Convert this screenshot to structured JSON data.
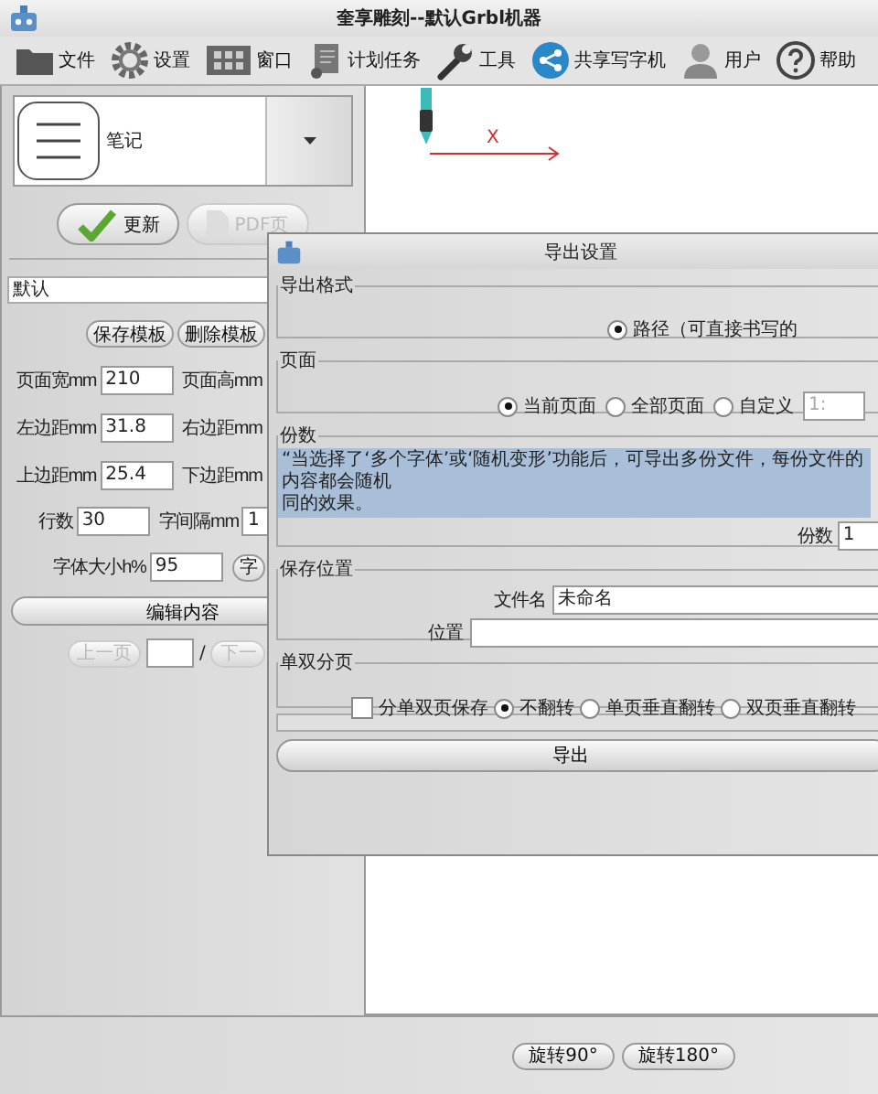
{
  "window": {
    "title": "奎享雕刻--默认Grbl机器"
  },
  "toolbar": [
    {
      "label": "文件",
      "kind": "folder"
    },
    {
      "label": "设置",
      "kind": "gear"
    },
    {
      "label": "窗口",
      "kind": "window"
    },
    {
      "label": "计划任务",
      "kind": "scroll"
    },
    {
      "label": "工具",
      "kind": "wrench"
    },
    {
      "label": "共享写字机",
      "kind": "share"
    },
    {
      "label": "用户",
      "kind": "user"
    },
    {
      "label": "帮助",
      "kind": "help"
    }
  ],
  "template_selector": {
    "value": "笔记"
  },
  "action_buttons": [
    {
      "label": "更新",
      "disabled": false,
      "kind": "check"
    },
    {
      "label": "PDF页",
      "disabled": true,
      "kind": "doc"
    }
  ],
  "template_name": "默认",
  "template_buttons": [
    "保存模板",
    "删除模板"
  ],
  "page_fields": [
    [
      {
        "label": "页面宽mm",
        "value": "210"
      },
      {
        "label": "页面高mm"
      }
    ],
    [
      {
        "label": "左边距mm",
        "value": "31.8"
      },
      {
        "label": "右边距mm"
      }
    ],
    [
      {
        "label": "上边距mm",
        "value": "25.4"
      },
      {
        "label": "下边距mm"
      }
    ]
  ],
  "line_fields": [
    {
      "label": "行数",
      "value": "30"
    },
    {
      "label": "字间隔mm",
      "value": "1"
    }
  ],
  "font_size": {
    "label": "字体大小h%",
    "value": "95",
    "button": "字"
  },
  "edit_button": "编辑内容",
  "pager": {
    "prev": "上一页",
    "prev_disabled": true,
    "separator": "/",
    "next": "下一",
    "next_disabled": true
  },
  "canvas": {
    "axis_label": "X"
  },
  "rotate_buttons": [
    "旋转90°",
    "旋转180°"
  ],
  "dialog": {
    "title": "导出设置",
    "format": {
      "legend": "导出格式",
      "options": [
        {
          "label": "路径（可直接书写的",
          "selected": true
        }
      ]
    },
    "pages": {
      "legend": "页面",
      "options": [
        {
          "label": "当前页面",
          "selected": true
        },
        {
          "label": "全部页面",
          "selected": false
        },
        {
          "label": "自定义",
          "selected": false
        }
      ],
      "custom_placeholder": "1:"
    },
    "copies": {
      "legend": "份数",
      "notice": [
        "“当选择了‘多个字体’或‘随机变形’功能后，可导出多份文件，每份文件的内容都会随机",
        "同的效果。"
      ],
      "label": "份数",
      "value": "1"
    },
    "save": {
      "legend": "保存位置",
      "filename_label": "文件名",
      "filename": "未命名",
      "location_label": "位置"
    },
    "duplex": {
      "legend": "单双分页",
      "checkbox": {
        "label": "分单双页保存",
        "checked": false
      },
      "options": [
        {
          "label": "不翻转",
          "selected": true
        },
        {
          "label": "单页垂直翻转",
          "selected": false
        },
        {
          "label": "双页垂直翻转",
          "selected": false
        }
      ]
    },
    "progress": {
      "level": 0
    },
    "export_button": "导出"
  }
}
